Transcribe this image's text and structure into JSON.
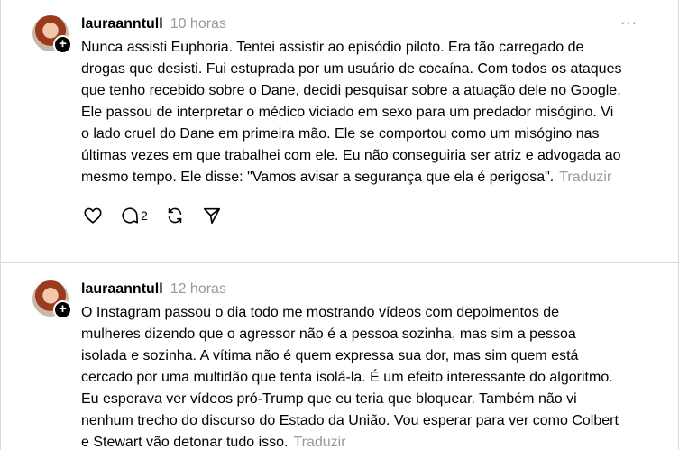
{
  "posts": [
    {
      "username": "lauraanntull",
      "time": "10 horas",
      "more": "···",
      "text": "Nunca assisti Euphoria. Tentei assistir ao episódio piloto. Era tão carregado de drogas que desisti. Fui estuprada por um usuário de cocaína. Com todos os ataques que tenho recebido sobre o Dane, decidi pesquisar sobre a atuação dele no Google. Ele passou de interpretar o médico viciado em sexo para um predador misógino. Vi o lado cruel do Dane em primeira mão. Ele se comportou como um misógino nas últimas vezes em que trabalhei com ele. Eu não conseguiria ser atriz e advogada ao mesmo tempo. Ele disse: \"Vamos avisar a segurança que ela é perigosa\".",
      "translate": "Traduzir",
      "actions": {
        "reply_count": "2"
      }
    },
    {
      "username": "lauraanntull",
      "time": "12 horas",
      "text": "O Instagram passou o dia todo me mostrando vídeos com depoimentos de mulheres dizendo que o agressor não é a pessoa sozinha, mas sim a pessoa isolada e sozinha. A vítima não é quem expressa sua dor, mas sim quem está cercado por uma multidão que tenta isolá-la. É um efeito interessante do algoritmo. Eu esperava ver vídeos pró-Trump que eu teria que bloquear. Também não vi nenhum trecho do discurso do Estado da União. Vou esperar para ver como Colbert e Stewart vão detonar tudo isso.",
      "translate": "Traduzir"
    }
  ],
  "icons": {
    "avatar_badge": "plus-icon",
    "like": "heart-icon",
    "reply": "comment-icon",
    "repost": "repost-icon",
    "share": "send-icon"
  }
}
